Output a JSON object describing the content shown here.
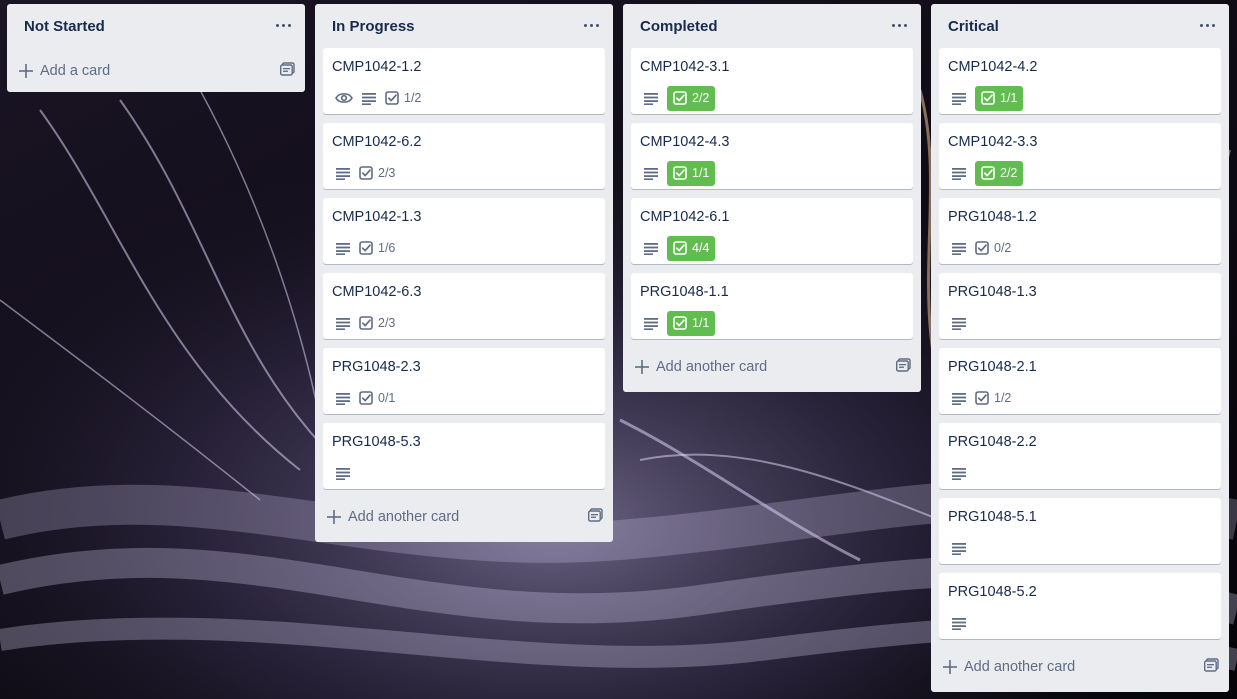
{
  "lists": [
    {
      "title": "Not Started",
      "footer_label": "Add a card",
      "cards": []
    },
    {
      "title": "In Progress",
      "footer_label": "Add another card",
      "cards": [
        {
          "title": "CMP1042-1.2",
          "watch": true,
          "desc": true,
          "checklist": "1/2",
          "complete": false
        },
        {
          "title": "CMP1042-6.2",
          "watch": false,
          "desc": true,
          "checklist": "2/3",
          "complete": false
        },
        {
          "title": "CMP1042-1.3",
          "watch": false,
          "desc": true,
          "checklist": "1/6",
          "complete": false
        },
        {
          "title": "CMP1042-6.3",
          "watch": false,
          "desc": true,
          "checklist": "2/3",
          "complete": false
        },
        {
          "title": "PRG1048-2.3",
          "watch": false,
          "desc": true,
          "checklist": "0/1",
          "complete": false
        },
        {
          "title": "PRG1048-5.3",
          "watch": false,
          "desc": true,
          "checklist": "",
          "complete": false
        }
      ]
    },
    {
      "title": "Completed",
      "footer_label": "Add another card",
      "cards": [
        {
          "title": "CMP1042-3.1",
          "watch": false,
          "desc": true,
          "checklist": "2/2",
          "complete": true
        },
        {
          "title": "CMP1042-4.3",
          "watch": false,
          "desc": true,
          "checklist": "1/1",
          "complete": true
        },
        {
          "title": "CMP1042-6.1",
          "watch": false,
          "desc": true,
          "checklist": "4/4",
          "complete": true
        },
        {
          "title": "PRG1048-1.1",
          "watch": false,
          "desc": true,
          "checklist": "1/1",
          "complete": true
        }
      ]
    },
    {
      "title": "Critical",
      "footer_label": "Add another card",
      "cards": [
        {
          "title": "CMP1042-4.2",
          "watch": false,
          "desc": true,
          "checklist": "1/1",
          "complete": true
        },
        {
          "title": "CMP1042-3.3",
          "watch": false,
          "desc": true,
          "checklist": "2/2",
          "complete": true
        },
        {
          "title": "PRG1048-1.2",
          "watch": false,
          "desc": true,
          "checklist": "0/2",
          "complete": false
        },
        {
          "title": "PRG1048-1.3",
          "watch": false,
          "desc": true,
          "checklist": "",
          "complete": false
        },
        {
          "title": "PRG1048-2.1",
          "watch": false,
          "desc": true,
          "checklist": "1/2",
          "complete": false
        },
        {
          "title": "PRG1048-2.2",
          "watch": false,
          "desc": true,
          "checklist": "",
          "complete": false
        },
        {
          "title": "PRG1048-5.1",
          "watch": false,
          "desc": true,
          "checklist": "",
          "complete": false
        },
        {
          "title": "PRG1048-5.2",
          "watch": false,
          "desc": true,
          "checklist": "",
          "complete": false
        }
      ]
    }
  ],
  "icons": {
    "menu": "more-horizontal-icon",
    "watch": "eye-icon",
    "description": "description-lines-icon",
    "checklist": "checklist-icon",
    "add": "plus-icon",
    "template": "card-template-icon"
  },
  "colors": {
    "list_bg": "#ebecf0",
    "card_bg": "#ffffff",
    "complete_badge": "#61bd4f",
    "text": "#172b4d",
    "muted": "#5e6c84"
  }
}
